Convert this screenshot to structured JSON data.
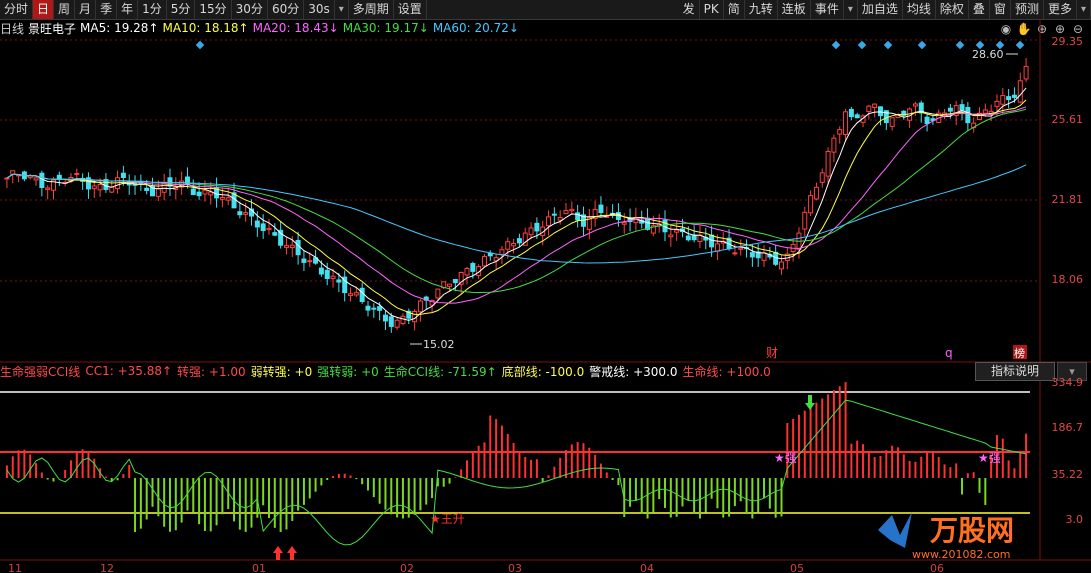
{
  "toolbar": {
    "left_items": [
      "分时",
      "日",
      "周",
      "月",
      "季",
      "年",
      "1分",
      "5分",
      "15分",
      "30分",
      "60分",
      "30s",
      "多周期",
      "设置"
    ],
    "active_item": "日",
    "dropdown_after": "30s",
    "right_items": [
      "发",
      "PK",
      "简",
      "九转",
      "连板",
      "事件",
      "加自选",
      "均线",
      "除权",
      "叠",
      "窗",
      "预测",
      "更多"
    ]
  },
  "ma_line": {
    "period_label": "日线",
    "stock_name": "景旺电子",
    "items": [
      {
        "label": "MA5: 19.28↑",
        "color": "#ffffff"
      },
      {
        "label": "MA10: 18.18↑",
        "color": "#ffff44"
      },
      {
        "label": "MA20: 18.43↓",
        "color": "#ff66ff"
      },
      {
        "label": "MA30: 19.17↓",
        "color": "#44dd44"
      },
      {
        "label": "MA60: 20.72↓",
        "color": "#44c8ff"
      }
    ]
  },
  "chart_icons": [
    "◉",
    "✋",
    "⊕",
    "⊕",
    "⊖"
  ],
  "price_axis": [
    "29.35",
    "25.61",
    "21.81",
    "18.06"
  ],
  "annotations": {
    "high": "28.60",
    "low": "15.02",
    "cai": "财",
    "q": "q",
    "bang": "榜",
    "wangsheng": "★王升",
    "qiang1": "★强",
    "qiang2": "★强"
  },
  "indicator_line": [
    {
      "label": "生命强弱CCI线",
      "color": "#ff4a4a"
    },
    {
      "label": "CC1: +35.88↑",
      "color": "#ff4a4a"
    },
    {
      "label": "转强: +1.00",
      "color": "#ff4a4a"
    },
    {
      "label": "弱转强: +0",
      "color": "#ffff44"
    },
    {
      "label": "强转弱: +0",
      "color": "#44dd44"
    },
    {
      "label": "生命CCI线: -71.59↑",
      "color": "#44dd44"
    },
    {
      "label": "底部线: -100.0",
      "color": "#ffff44"
    },
    {
      "label": "警戒线: +300.0",
      "color": "#ffffff"
    },
    {
      "label": "生命线: +100.0",
      "color": "#ff4a4a"
    }
  ],
  "indicator_button": "指标说明",
  "indicator_axis": [
    "334.9",
    "186.7",
    "35.22",
    "3.0"
  ],
  "date_axis": [
    "11",
    "12",
    "01",
    "02",
    "03",
    "04",
    "05",
    "06"
  ],
  "watermark": {
    "brand": "万股网",
    "url": "www.201082.com"
  },
  "chart_data": {
    "type": "candlestick",
    "series_ma": [
      "MA5",
      "MA10",
      "MA20",
      "MA30",
      "MA60"
    ],
    "price_range": [
      15.0,
      30.0
    ],
    "low": 15.02,
    "high": 28.6,
    "indicator_range": [
      -150,
      350
    ]
  }
}
